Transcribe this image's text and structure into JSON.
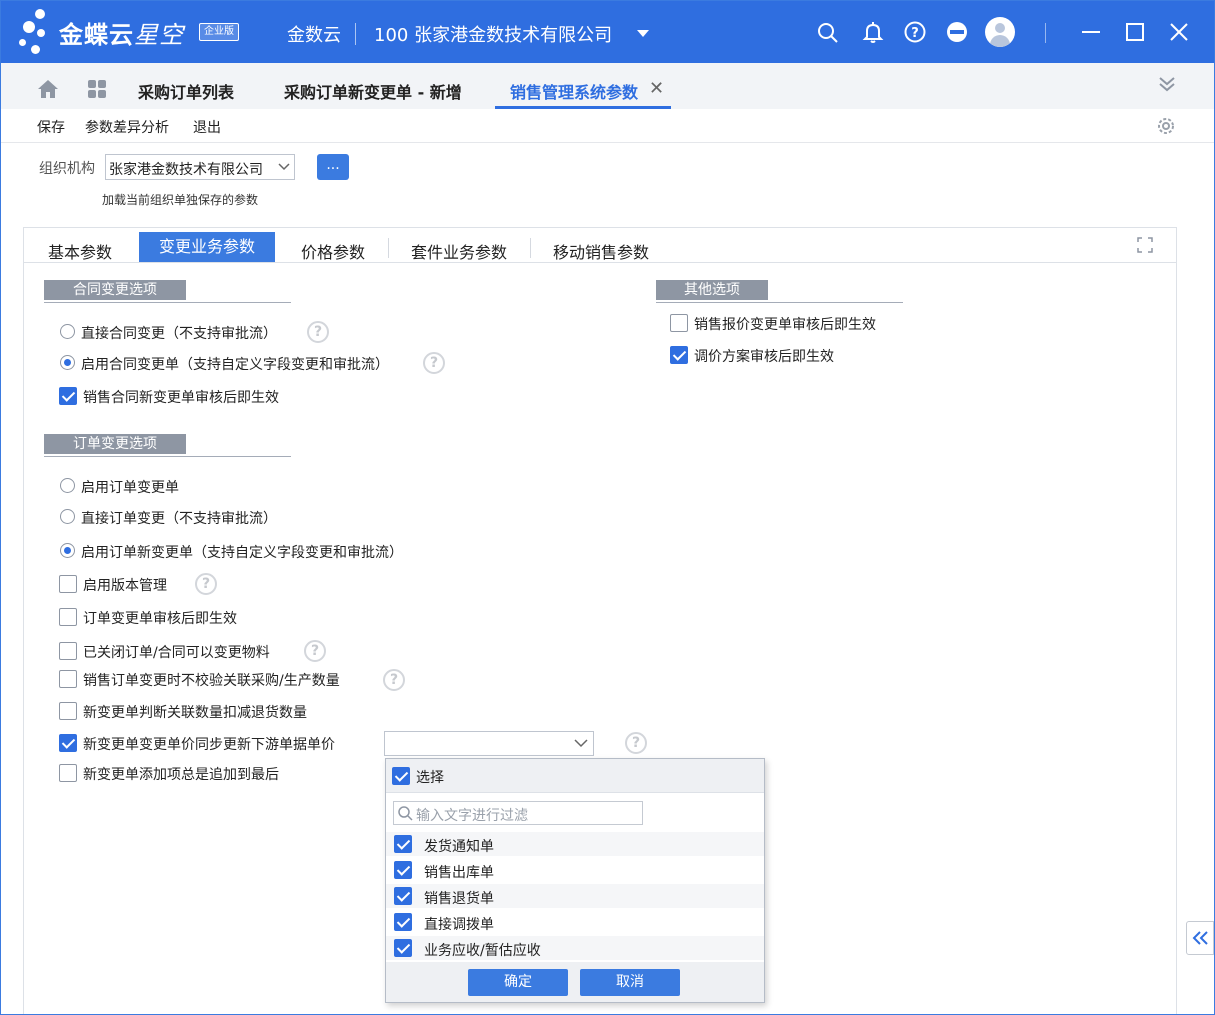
{
  "titlebar": {
    "brand_main": "金蝶云",
    "brand_star": "星空",
    "edition": "企业版",
    "cloud_name": "金数云",
    "company": "100  张家港金数技术有限公司",
    "icons": [
      "search-icon",
      "bell-icon",
      "help-circle-icon",
      "no-entry-icon",
      "user-avatar",
      "minimize-icon",
      "maximize-icon",
      "close-icon"
    ]
  },
  "page_tabs": [
    {
      "label": "采购订单列表",
      "active": false
    },
    {
      "label": "采购订单新变更单 - 新增",
      "active": false
    },
    {
      "label": "销售管理系统参数",
      "active": true
    }
  ],
  "toolbar": {
    "save": "保存",
    "diff": "参数差异分析",
    "exit": "退出"
  },
  "org": {
    "label": "组织机构",
    "value": "张家港金数技术有限公司",
    "more_btn": "...",
    "note": "加载当前组织单独保存的参数"
  },
  "sub_tabs": [
    {
      "label": "基本参数",
      "active": false
    },
    {
      "label": "变更业务参数",
      "active": true
    },
    {
      "label": "价格参数",
      "active": false
    },
    {
      "label": "套件业务参数",
      "active": false
    },
    {
      "label": "移动销售参数",
      "active": false
    }
  ],
  "contract_section": {
    "title": "合同变更选项",
    "options": [
      {
        "type": "radio",
        "label": "直接合同变更（不支持审批流）",
        "checked": false,
        "help": true
      },
      {
        "type": "radio",
        "label": "启用合同变更单（支持自定义字段变更和审批流）",
        "checked": true,
        "help": true
      },
      {
        "type": "checkbox",
        "label": "销售合同新变更单审核后即生效",
        "checked": true,
        "help": false
      }
    ]
  },
  "other_section": {
    "title": "其他选项",
    "options": [
      {
        "type": "checkbox",
        "label": "销售报价变更单审核后即生效",
        "checked": false
      },
      {
        "type": "checkbox",
        "label": "调价方案审核后即生效",
        "checked": true
      }
    ]
  },
  "order_section": {
    "title": "订单变更选项",
    "options": [
      {
        "type": "radio",
        "label": "启用订单变更单",
        "checked": false,
        "help": false
      },
      {
        "type": "radio",
        "label": "直接订单变更（不支持审批流）",
        "checked": false,
        "help": false
      },
      {
        "type": "radio",
        "label": "启用订单新变更单（支持自定义字段变更和审批流）",
        "checked": true,
        "help": false
      },
      {
        "type": "checkbox",
        "label": "启用版本管理",
        "checked": false,
        "help": true
      },
      {
        "type": "checkbox",
        "label": "订单变更单审核后即生效",
        "checked": false,
        "help": false
      },
      {
        "type": "checkbox",
        "label": "已关闭订单/合同可以变更物料",
        "checked": false,
        "help": true
      },
      {
        "type": "checkbox",
        "label": "销售订单变更时不校验关联采购/生产数量",
        "checked": false,
        "help": true
      },
      {
        "type": "checkbox",
        "label": "新变更单判断关联数量扣减退货数量",
        "checked": false,
        "help": false
      },
      {
        "type": "checkbox",
        "label": "新变更单变更单价同步更新下游单据单价",
        "checked": true,
        "help": true
      },
      {
        "type": "checkbox",
        "label": "新变更单添加项总是追加到最后",
        "checked": false,
        "help": false
      }
    ]
  },
  "dropdown": {
    "select_all_label": "选择",
    "select_all_checked": true,
    "search_placeholder": "输入文字进行过滤",
    "items": [
      {
        "label": "发货通知单",
        "checked": true
      },
      {
        "label": "销售出库单",
        "checked": true
      },
      {
        "label": "销售退货单",
        "checked": true
      },
      {
        "label": "直接调拨单",
        "checked": true
      },
      {
        "label": "业务应收/暂估应收",
        "checked": true
      }
    ],
    "ok": "确定",
    "cancel": "取消"
  },
  "help_glyph": "?",
  "colors": {
    "primary": "#2f6ee0",
    "section_header": "#8e96a3"
  }
}
